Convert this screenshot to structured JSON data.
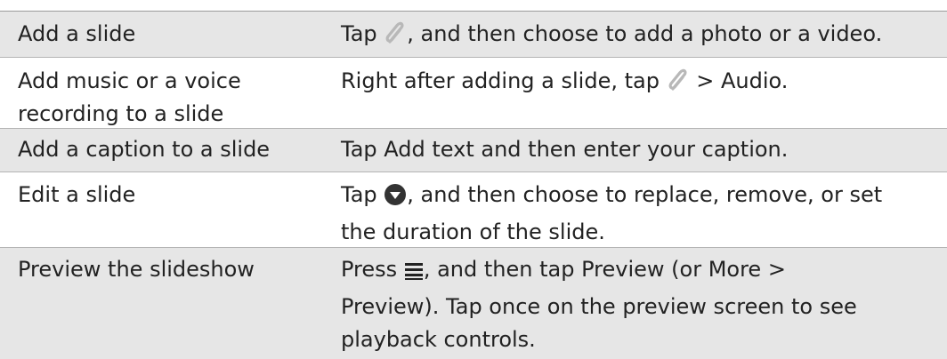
{
  "rows": [
    {
      "action": "Add a slide",
      "desc": {
        "pre": "Tap",
        "icon": "paperclip-icon",
        "post": ", and then choose to add a photo or a video."
      }
    },
    {
      "action_line1": "Add music or a voice",
      "action_line2": "recording to a slide",
      "desc": {
        "pre": "Right after adding a slide, tap",
        "icon": "paperclip-icon",
        "sep": ">",
        "emph": "Audio",
        "post": "."
      }
    },
    {
      "action": "Add a caption to a slide",
      "desc": {
        "pre": "Tap",
        "emph": "Add text",
        "post": "and then enter your caption."
      }
    },
    {
      "action": "Edit a slide",
      "desc": {
        "pre": "Tap",
        "icon": "dropdown-circle-icon",
        "post_line1": ", and then choose to replace, remove, or set",
        "post_line2": "the duration of the slide."
      }
    },
    {
      "action": "Preview the slideshow",
      "desc": {
        "pre": "Press",
        "icon": "menu-icon",
        "mid1": ", and then tap",
        "emph1": "Preview",
        "mid2": "(or",
        "emph2": "More",
        "sep": ">",
        "emph3": "Preview",
        "post": "). Tap once on the preview screen to see",
        "post_line3": "playback controls."
      }
    }
  ],
  "colors": {
    "shade": "#e6e6e6",
    "text": "#222222",
    "icon": "#b8b8b8"
  }
}
